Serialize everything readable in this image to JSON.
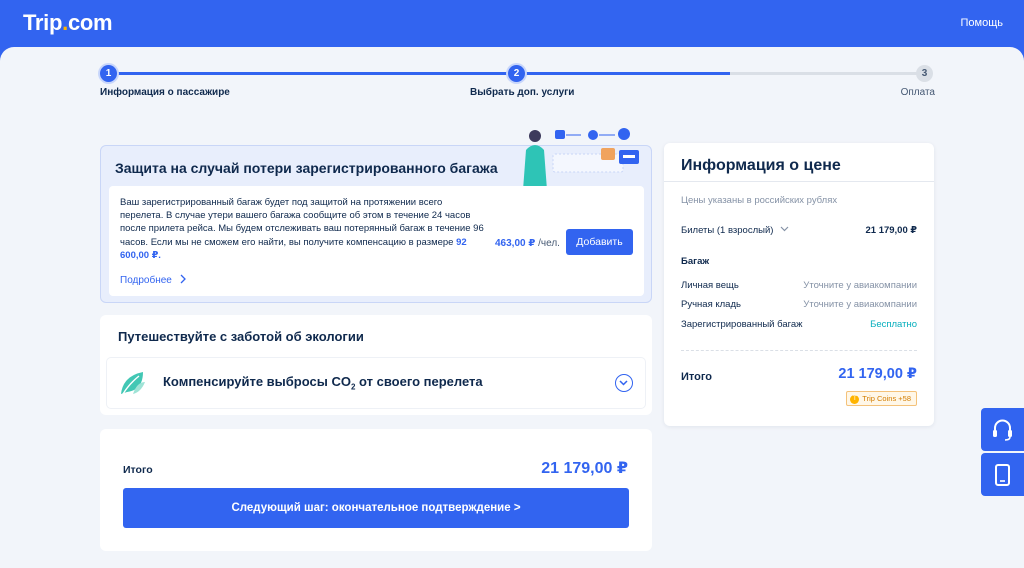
{
  "header": {
    "logo_main": "Trip",
    "logo_dot": ".",
    "logo_suffix": "com",
    "help": "Помощь"
  },
  "progress": {
    "steps": [
      {
        "number": "1",
        "label": "Информация о пассажире"
      },
      {
        "number": "2",
        "label": "Выбрать доп. услуги"
      },
      {
        "number": "3",
        "label": "Оплата"
      }
    ],
    "fill_fraction": 0.76
  },
  "baggage": {
    "title": "Защита на случай потери зарегистрированного багажа",
    "description": "Ваш зарегистрированный багаж будет под защитой на протяжении всего перелета. В случае утери вашего багажа сообщите об этом в течение 24 часов после прилета рейса. Мы будем отслеживать ваш потерянный багаж в течение 96 часов. Если мы не сможем его найти, вы получите компенсацию в размере",
    "compensation": "92 600,00 ₽.",
    "more": "Подробнее",
    "price": "463,00 ₽",
    "per": " /чел.",
    "add": "Добавить"
  },
  "eco": {
    "title": "Путешествуйте с заботой об экологии",
    "offset_pre": "Компенсируйте выбросы CO",
    "offset_sub": "2",
    "offset_post": " от своего перелета"
  },
  "total": {
    "label": "Итого",
    "amount": "21 179,00 ₽",
    "next": "Следующий шаг: окончательное подтверждение >"
  },
  "price_info": {
    "title": "Информация о цене",
    "note": "Цены указаны в российских рублях",
    "tickets_label": "Билеты (1 взрослый)",
    "tickets_amount": "21 179,00 ₽",
    "baggage_heading": "Багаж",
    "baggage_rows": [
      {
        "label": "Личная вещь",
        "value": "Уточните у авиакомпании"
      },
      {
        "label": "Ручная кладь",
        "value": "Уточните у авиакомпании"
      },
      {
        "label": "Зарегистрированный багаж",
        "value": "Бесплатно"
      }
    ],
    "total_label": "Итого",
    "total_amount": "21 179,00 ₽",
    "coins": "Trip Coins +58"
  },
  "colors": {
    "brand": "#3264f0",
    "accent_yellow": "#ffb400",
    "free_teal": "#06aebd"
  },
  "icons": [
    "chevron-right-icon",
    "chevron-down-icon",
    "leaf-icon",
    "headset-icon",
    "phone-icon",
    "coin-icon"
  ]
}
